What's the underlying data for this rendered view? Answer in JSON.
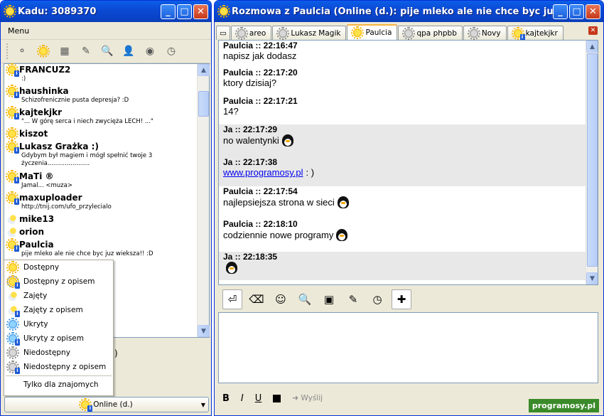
{
  "left_window": {
    "title": "Kadu: 3089370",
    "menu_label": "Menu",
    "contacts": [
      {
        "name": "FRANCUZ2",
        "desc": ":)",
        "icon": "sun-info"
      },
      {
        "name": "haushinka",
        "desc": "Schizofrenicznie pusta depresja? :D",
        "icon": "sun-info"
      },
      {
        "name": "kajtekjkr",
        "desc": "\"... W górę serca i niech zwycięża LECH! ...\"",
        "icon": "sun-info"
      },
      {
        "name": "kiszot",
        "desc": "",
        "icon": "sun"
      },
      {
        "name": "Lukasz Grażka :)",
        "desc": "Gdybym był magiem i mógł spełnić twoje 3 życzenia......................",
        "icon": "sun-info"
      },
      {
        "name": "MaTi ®",
        "desc": "Jamal... <muza>",
        "icon": "sun-info"
      },
      {
        "name": "maxuploader",
        "desc": "http://tnij.com/ufo_przylecialo",
        "icon": "sun-info"
      },
      {
        "name": "mike13",
        "desc": "",
        "icon": "cloud"
      },
      {
        "name": "orion",
        "desc": "",
        "icon": "cloud"
      },
      {
        "name": "Paulcia",
        "desc": "pije mleko ale nie chce byc juz wieksza!! :D",
        "icon": "sun-info"
      }
    ],
    "status_menu": [
      {
        "label": "Dostępny",
        "icon": "sun"
      },
      {
        "label": "Dostępny z opisem",
        "icon": "sun-info"
      },
      {
        "label": "Zajęty",
        "icon": "cloud"
      },
      {
        "label": "Zajęty z opisem",
        "icon": "cloud-info"
      },
      {
        "label": "Ukryty",
        "icon": "blue"
      },
      {
        "label": "Ukryty z opisem",
        "icon": "blue-info"
      },
      {
        "label": "Niedostępny",
        "icon": "gray"
      },
      {
        "label": "Niedostępny z opisem",
        "icon": "gray-info"
      }
    ],
    "status_friends_only": "Tylko dla znajomych",
    "status_button": "Online (d.)",
    "hidden_fragment": ")"
  },
  "right_window": {
    "title": "Rozmowa z Paulcia (Online (d.): pije mleko ale nie chce byc juz wieks…",
    "tabs": [
      {
        "label": "areo",
        "icon": "gray"
      },
      {
        "label": "Lukasz Magik",
        "icon": "gray"
      },
      {
        "label": "Paulcia",
        "icon": "sun",
        "active": true
      },
      {
        "label": "qpa phpbb",
        "icon": "gray"
      },
      {
        "label": "Novy",
        "icon": "gray"
      },
      {
        "label": "kajtekjkr",
        "icon": "sun-info"
      }
    ],
    "messages": [
      {
        "head": "Paulcia :: 22:16:47",
        "text": "napisz jak dodasz",
        "me": false
      },
      {
        "head": "Paulcia :: 22:17:20",
        "text": "ktory dzisiaj?",
        "me": false
      },
      {
        "head": "Paulcia :: 22:17:21",
        "text": "14?",
        "me": false
      },
      {
        "head": "Ja :: 22:17:29",
        "text": "no walentynki",
        "me": true,
        "emote": true
      },
      {
        "head": "Ja :: 22:17:38",
        "link": "www.programosy.pl",
        "text": " : )",
        "me": true
      },
      {
        "head": "Paulcia :: 22:17:54",
        "text": "najlepsiejsza strona w sieci",
        "me": false,
        "emote": true
      },
      {
        "head": "Paulcia :: 22:18:10",
        "text": "codziennie nowe programy",
        "me": false,
        "emote": true
      },
      {
        "head": "Ja :: 22:18:35",
        "text": "",
        "me": true,
        "emote": true
      }
    ],
    "format": {
      "bold": "B",
      "italic": "I",
      "underline": "U"
    },
    "send_label": "Wyślij"
  },
  "watermark": "programosy.pl"
}
